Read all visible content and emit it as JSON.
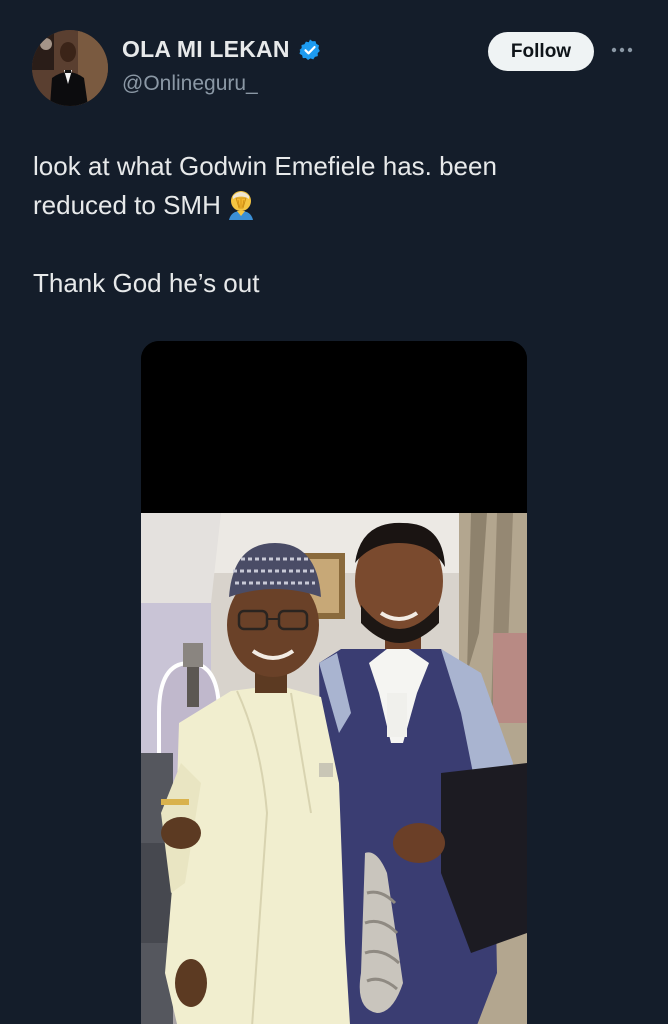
{
  "author": {
    "display_name": "OLA MI LEKAN",
    "handle": "@Onlineguru_",
    "verified": true,
    "avatar_icon": "avatar-photo"
  },
  "actions": {
    "follow_label": "Follow",
    "more_icon": "more-horizontal-icon"
  },
  "tweet": {
    "line1": "look at what Godwin Emefiele has. been",
    "line2": "reduced to SMH",
    "line2_emoji": "man-facepalming",
    "line3": "Thank God he’s out"
  },
  "media": {
    "type": "photo"
  },
  "colors": {
    "background": "#141d2a",
    "text": "#e7e9ea",
    "secondary_text": "#8b98a5",
    "verified_blue": "#1d9bf0",
    "follow_bg": "#eff3f4"
  }
}
